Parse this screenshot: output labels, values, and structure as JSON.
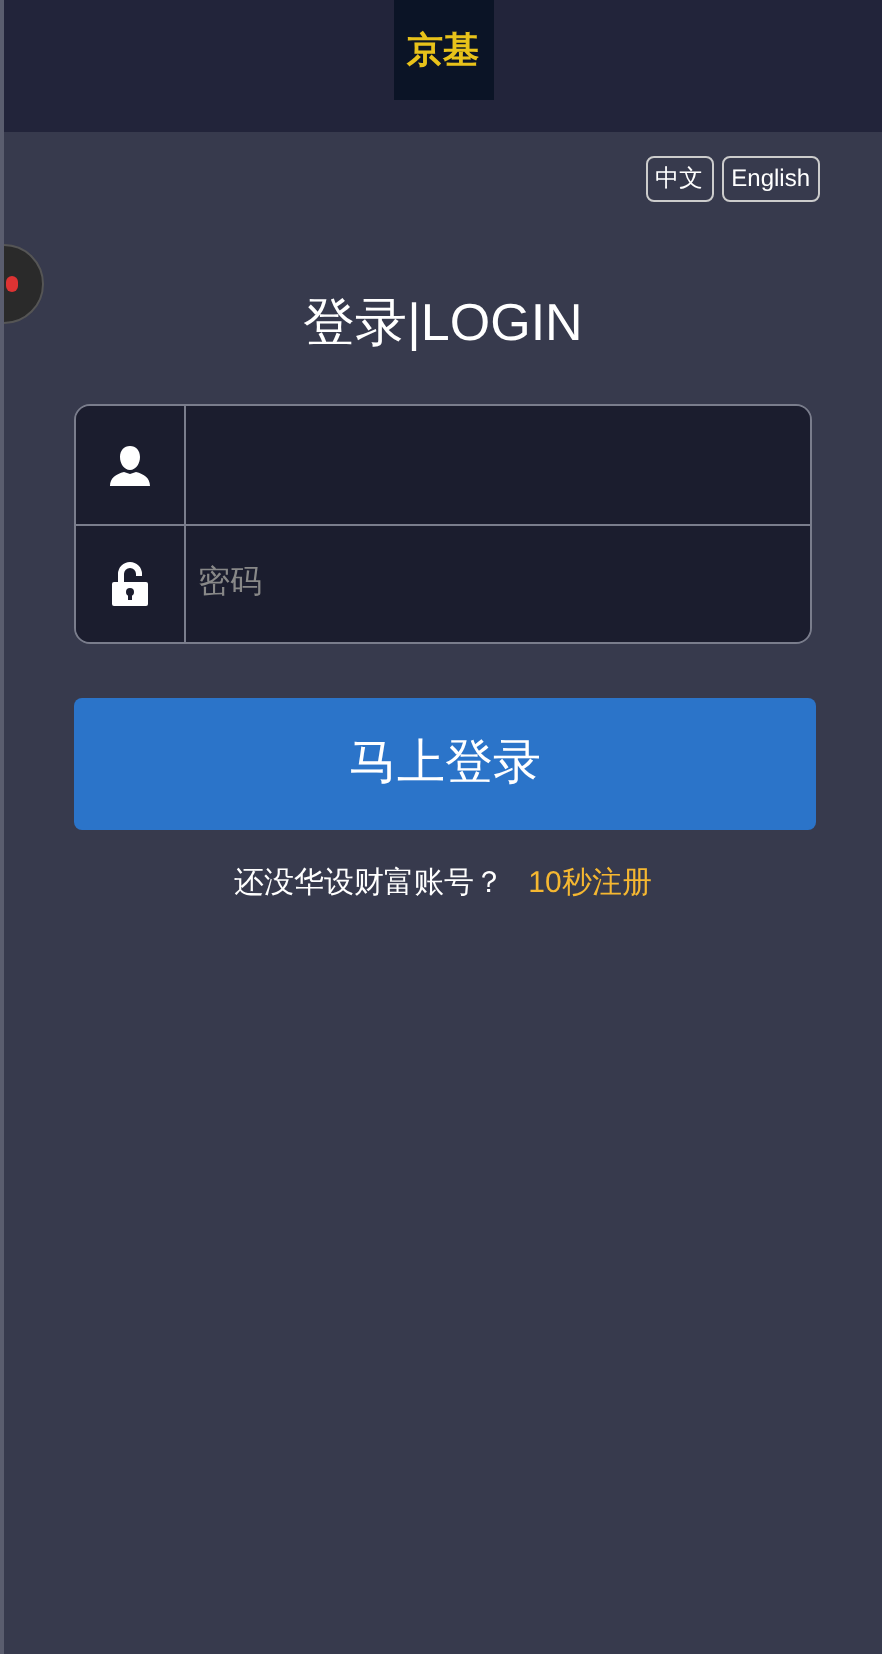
{
  "header": {
    "logo": "京基"
  },
  "languages": [
    {
      "label": "中文"
    },
    {
      "label": "English"
    }
  ],
  "title": "登录|LOGIN",
  "form": {
    "fields": [
      {
        "kind": "user"
      },
      {
        "kind": "password",
        "placeholder": "密码"
      }
    ]
  },
  "login_button": "马上登录",
  "register": {
    "prompt": "还没华设财富账号？",
    "link": "10秒注册"
  }
}
